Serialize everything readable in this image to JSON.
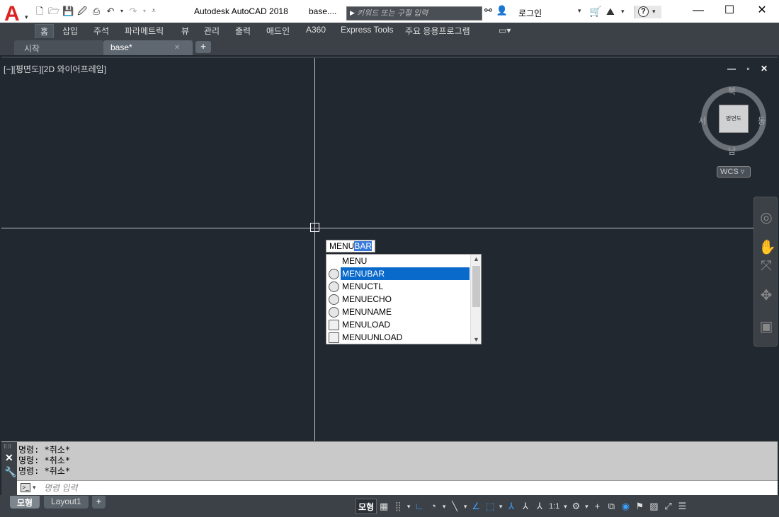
{
  "app": {
    "title": "Autodesk AutoCAD 2018",
    "file": "base....",
    "logo_letter": "A"
  },
  "quick_access": [
    "new-icon",
    "open-icon",
    "save-icon",
    "saveas-icon",
    "plot-icon",
    "undo-icon",
    "redo-icon",
    "customize-icon"
  ],
  "search": {
    "placeholder": "키워드 또는 구절 입력"
  },
  "account": {
    "login_label": "로그인"
  },
  "window_controls": {
    "minimize": "—",
    "maximize": "☐",
    "close": "✕"
  },
  "ribbon_tabs": [
    "홈",
    "삽입",
    "주석",
    "파라메트릭",
    "뷰",
    "관리",
    "출력",
    "애드인",
    "A360",
    "Express Tools",
    "주요 응용프로그램"
  ],
  "ribbon_active": "홈",
  "doc_tabs": [
    {
      "label": "시작",
      "active": false
    },
    {
      "label": "base*",
      "active": true,
      "close": "✕"
    }
  ],
  "new_tab": "+",
  "viewport": {
    "label": "[−][평면도][2D 와이어프레임]",
    "controls": "— ▫ ✕"
  },
  "viewcube": {
    "north": "북",
    "south": "남",
    "east": "동",
    "west": "서",
    "face": "평면도",
    "wcs": "WCS ▿"
  },
  "dynamic_input": {
    "typed": "MENU",
    "suggested": "BAR"
  },
  "autocomplete": {
    "items": [
      {
        "label": "MENU",
        "icon": "none"
      },
      {
        "label": "MENUBAR",
        "icon": "gear-icon",
        "selected": true
      },
      {
        "label": "MENUCTL",
        "icon": "gear-icon"
      },
      {
        "label": "MENUECHO",
        "icon": "gear-icon"
      },
      {
        "label": "MENUNAME",
        "icon": "gear-icon"
      },
      {
        "label": "MENULOAD",
        "icon": "doc-icon"
      },
      {
        "label": "MENUUNLOAD",
        "icon": "doc-icon"
      }
    ]
  },
  "command_line": {
    "history": [
      "명령: *취소*",
      "명령: *취소*",
      "명령: *취소*"
    ],
    "placeholder": "명령 입력"
  },
  "layout_tabs": [
    {
      "label": "모형",
      "active": true
    },
    {
      "label": "Layout1",
      "active": false
    },
    {
      "label": "+",
      "active": false
    }
  ],
  "status": {
    "model_label": "모형",
    "scale": "1:1"
  }
}
